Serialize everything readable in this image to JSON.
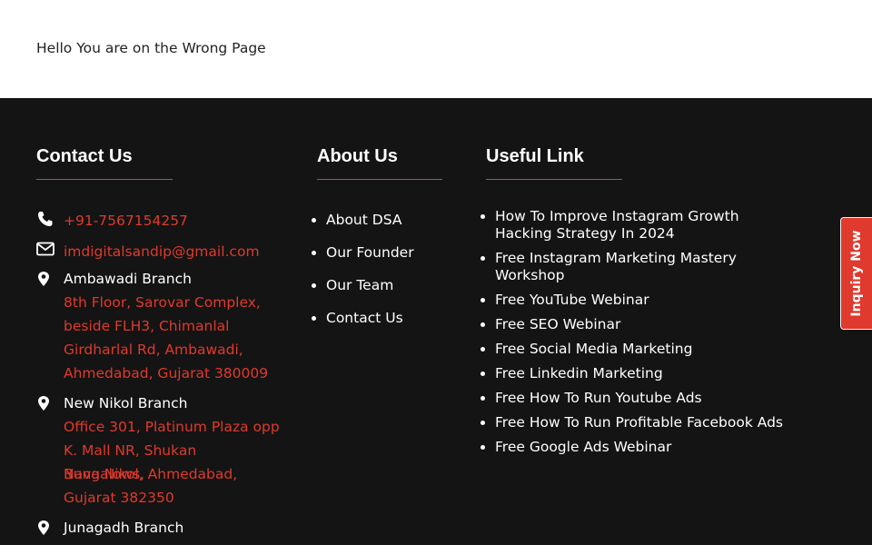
{
  "page": {
    "message": "Hello You are on the Wrong Page"
  },
  "footer": {
    "contact": {
      "title": "Contact Us",
      "phone": "+91-7567154257",
      "email": "imdigitalsandip@gmail.com",
      "branches": [
        {
          "name": "Ambawadi Branch",
          "address": [
            "8th Floor, Sarovar Complex,",
            "beside FLH3, Chimanlal",
            "Girdharlal Rd, Ambawadi,",
            "Ahmedabad, Gujarat 380009"
          ]
        },
        {
          "name": "New Nikol Branch",
          "address": [
            "Office 301, Platinum Plaza opp",
            "K. Mall NR, Shukan Bungalows,",
            "Nava Nikol, Ahmedabad,",
            "Gujarat 382350"
          ]
        },
        {
          "name": "Junagadh Branch"
        }
      ]
    },
    "about": {
      "title": "About Us",
      "items": [
        "About DSA",
        "Our Founder",
        "Our Team",
        "Contact Us"
      ]
    },
    "useful": {
      "title": "Useful Link",
      "items": [
        "How To Improve Instagram Growth Hacking Strategy In 2024",
        "Free Instagram Marketing Mastery Workshop",
        "Free YouTube Webinar",
        "Free SEO Webinar",
        "Free Social Media Marketing",
        "Free Linkedin Marketing",
        "Free How To Run Youtube Ads",
        "Free How To Run Profitable Facebook Ads",
        "Free Google Ads Webinar"
      ]
    }
  },
  "inquiry": {
    "label": "Inquiry Now"
  },
  "icons": {
    "phone": "phone-icon",
    "email": "envelope-icon",
    "location": "map-pin-icon"
  },
  "colors": {
    "footer_bg": "#141414",
    "accent": "#e0392d"
  }
}
